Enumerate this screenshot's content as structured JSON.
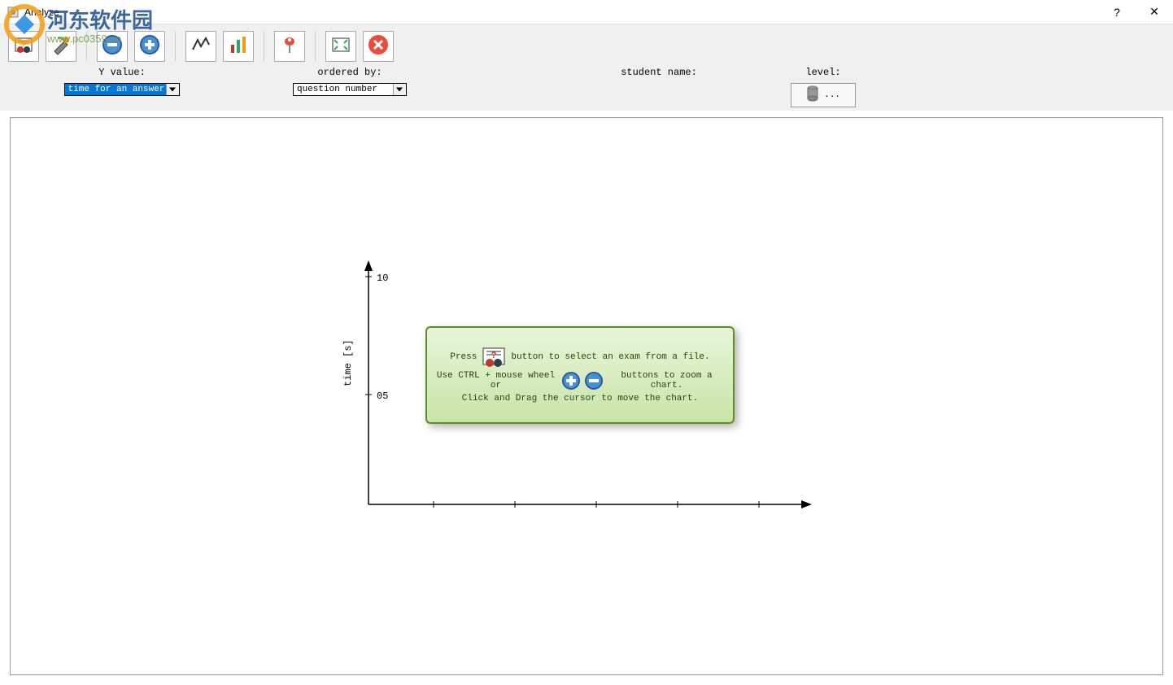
{
  "window": {
    "title": "Analyze"
  },
  "watermark": {
    "brand": "河东软件园",
    "url": "www.pc0359.cn"
  },
  "toolbar": {
    "buttons": [
      {
        "name": "open-exam-icon"
      },
      {
        "name": "settings-icon"
      },
      {
        "name": "zoom-out-icon"
      },
      {
        "name": "zoom-in-icon"
      },
      {
        "name": "line-chart-icon"
      },
      {
        "name": "bar-chart-icon"
      },
      {
        "name": "marker-icon"
      },
      {
        "name": "fit-screen-icon"
      },
      {
        "name": "close-circle-icon"
      }
    ]
  },
  "controls": {
    "y_value": {
      "label": "Y value:",
      "value": "time for an answer"
    },
    "ordered_by": {
      "label": "ordered by:",
      "value": "question number"
    },
    "student_name": {
      "label": "student name:",
      "value": ""
    },
    "level": {
      "label": "level:",
      "button_text": "..."
    }
  },
  "chart_data": {
    "type": "line",
    "title": "",
    "xlabel": "",
    "ylabel": "time [s]",
    "y_ticks": [
      "10",
      "05"
    ],
    "ylim": [
      0,
      10
    ],
    "series": []
  },
  "hint": {
    "line1_prefix": "Press",
    "line1_suffix": "button to select an exam from a file.",
    "line2_prefix": "Use CTRL + mouse wheel or",
    "line2_suffix": "buttons to zoom a chart.",
    "line3": "Click and Drag the cursor to move the chart."
  }
}
